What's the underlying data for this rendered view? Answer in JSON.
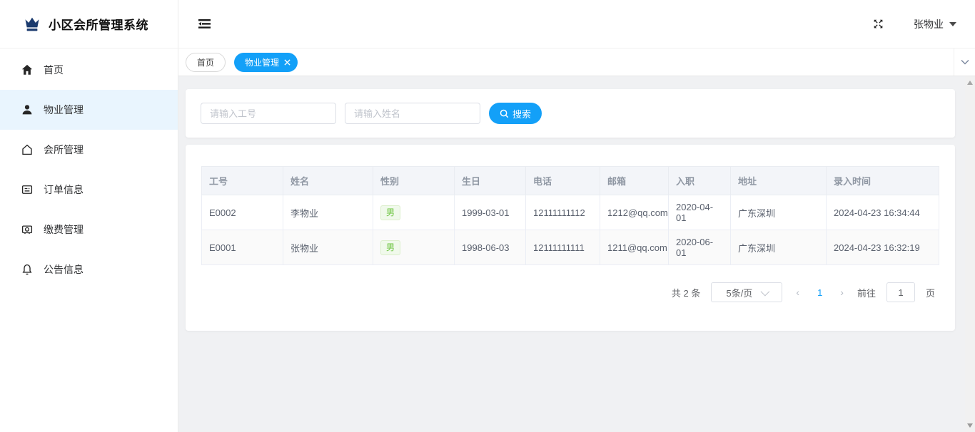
{
  "app": {
    "title": "小区会所管理系统",
    "user_name": "张物业"
  },
  "sidebar": {
    "items": [
      {
        "label": "首页",
        "icon": "home-icon",
        "active": false
      },
      {
        "label": "物业管理",
        "icon": "user-icon",
        "active": true
      },
      {
        "label": "会所管理",
        "icon": "house-icon",
        "active": false
      },
      {
        "label": "订单信息",
        "icon": "order-icon",
        "active": false
      },
      {
        "label": "缴费管理",
        "icon": "payment-icon",
        "active": false
      },
      {
        "label": "公告信息",
        "icon": "bell-icon",
        "active": false
      }
    ]
  },
  "tabs": [
    {
      "label": "首页",
      "active": false,
      "closable": false
    },
    {
      "label": "物业管理",
      "active": true,
      "closable": true
    }
  ],
  "search": {
    "employee_id_placeholder": "请输入工号",
    "name_placeholder": "请输入姓名",
    "button_label": "搜索"
  },
  "table": {
    "columns": [
      "工号",
      "姓名",
      "性别",
      "生日",
      "电话",
      "邮箱",
      "入职",
      "地址",
      "录入时间"
    ],
    "rows": [
      {
        "employee_id": "E0002",
        "name": "李物业",
        "gender": "男",
        "birthday": "1999-03-01",
        "phone": "12111111112",
        "email": "1212@qq.com",
        "hire_date": "2020-04-01",
        "address": "广东深圳",
        "created_at": "2024-04-23 16:34:44"
      },
      {
        "employee_id": "E0001",
        "name": "张物业",
        "gender": "男",
        "birthday": "1998-06-03",
        "phone": "12111111111",
        "email": "1211@qq.com",
        "hire_date": "2020-06-01",
        "address": "广东深圳",
        "created_at": "2024-04-23 16:32:19"
      }
    ]
  },
  "pagination": {
    "total_label": "共 2 条",
    "page_size_label": "5条/页",
    "current_page": "1",
    "goto_label": "前往",
    "goto_value": "1",
    "page_unit_label": "页"
  },
  "colors": {
    "accent": "#13a0f8",
    "logo": "#1a3a6e",
    "active_menu_bg": "#e9f5fe",
    "tag_success_text": "#67c23a",
    "tag_success_bg": "#f0f9eb"
  }
}
